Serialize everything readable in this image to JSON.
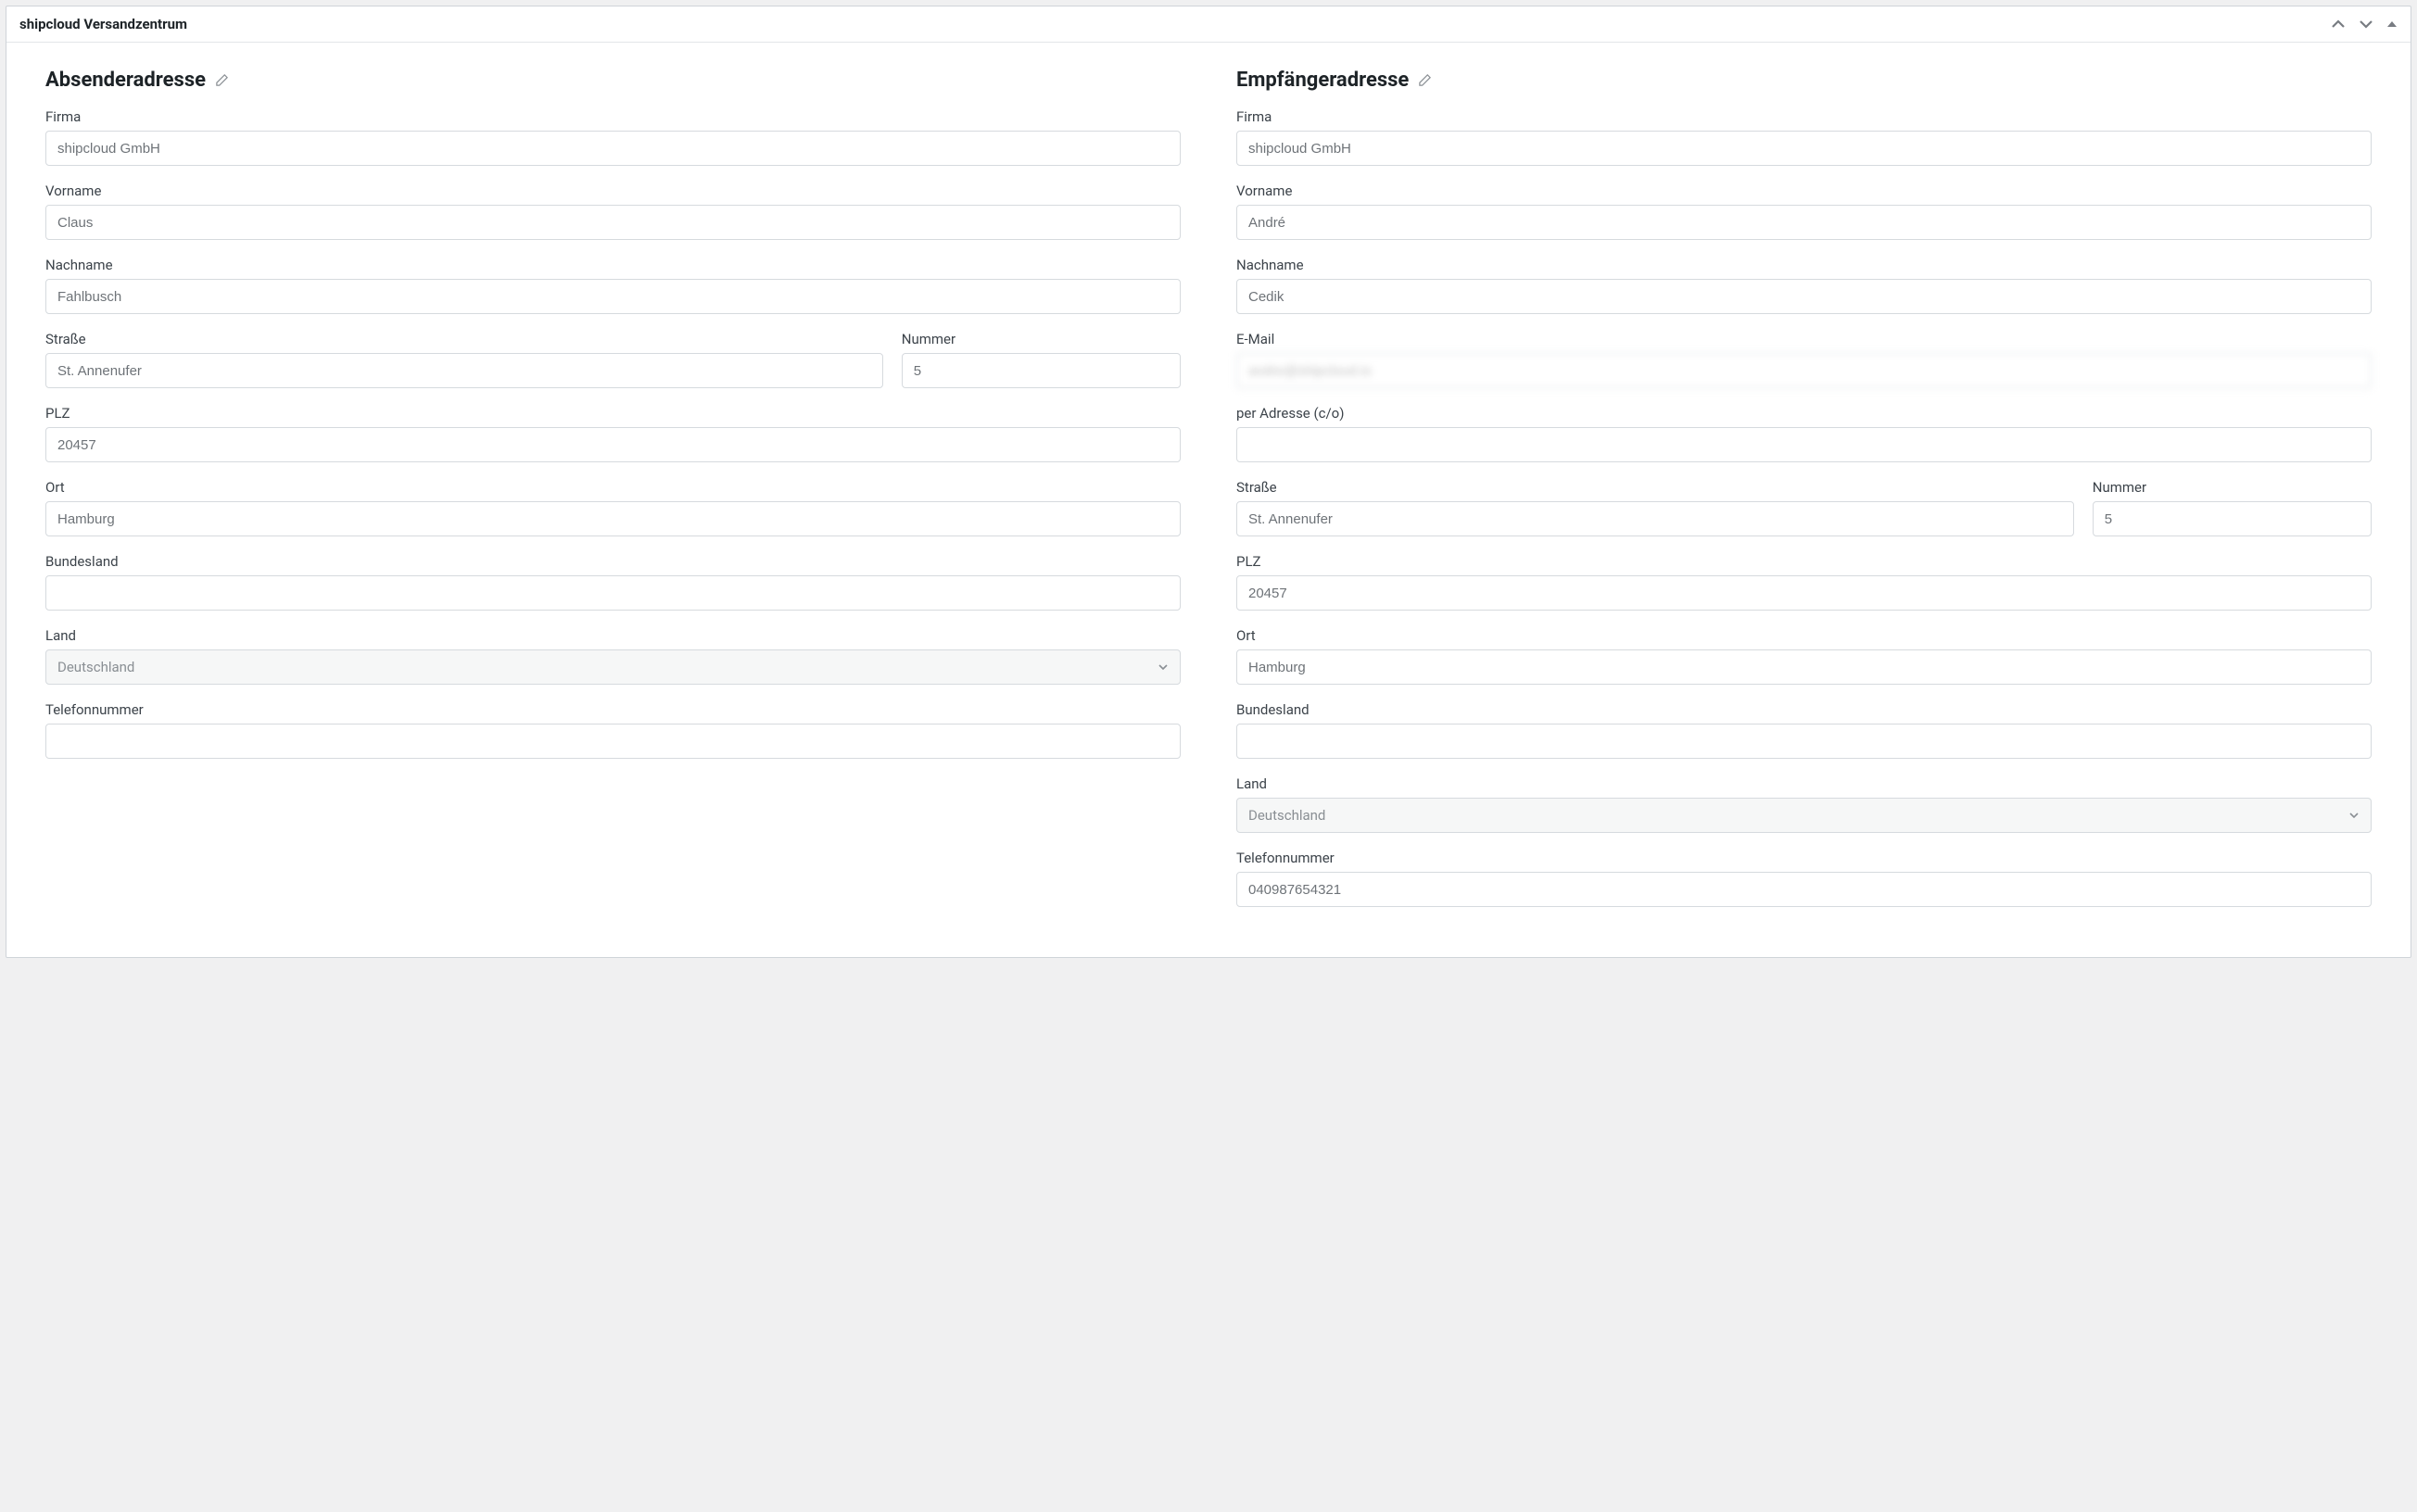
{
  "header": {
    "title": "shipcloud Versandzentrum"
  },
  "sender": {
    "heading": "Absenderadresse",
    "labels": {
      "company": "Firma",
      "firstname": "Vorname",
      "lastname": "Nachname",
      "street": "Straße",
      "number": "Nummer",
      "zip": "PLZ",
      "city": "Ort",
      "state": "Bundesland",
      "country": "Land",
      "phone": "Telefonnummer"
    },
    "values": {
      "company": "shipcloud GmbH",
      "firstname": "Claus",
      "lastname": "Fahlbusch",
      "street": "St. Annenufer",
      "number": "5",
      "zip": "20457",
      "city": "Hamburg",
      "state": "",
      "country": "Deutschland",
      "phone": ""
    }
  },
  "recipient": {
    "heading": "Empfängeradresse",
    "labels": {
      "company": "Firma",
      "firstname": "Vorname",
      "lastname": "Nachname",
      "email": "E-Mail",
      "careof": "per Adresse (c/o)",
      "street": "Straße",
      "number": "Nummer",
      "zip": "PLZ",
      "city": "Ort",
      "state": "Bundesland",
      "country": "Land",
      "phone": "Telefonnummer"
    },
    "values": {
      "company": "shipcloud GmbH",
      "firstname": "André",
      "lastname": "Cedik",
      "email": "andre@shipcloud.io",
      "careof": "",
      "street": "St. Annenufer",
      "number": "5",
      "zip": "20457",
      "city": "Hamburg",
      "state": "",
      "country": "Deutschland",
      "phone": "040987654321"
    }
  }
}
